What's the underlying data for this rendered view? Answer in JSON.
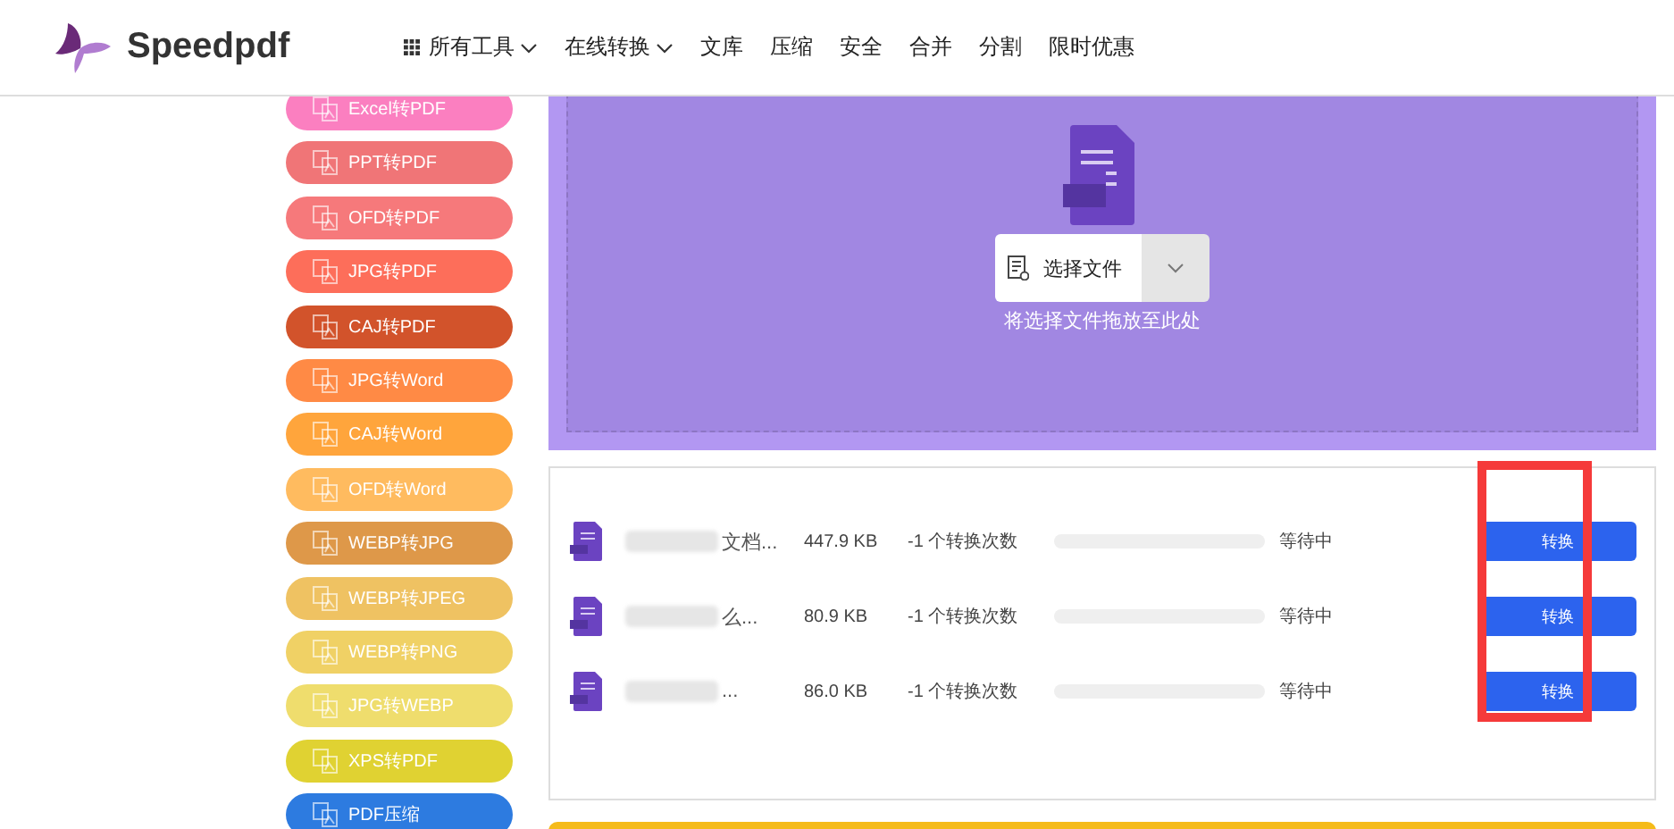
{
  "header": {
    "brand": "Speedpdf",
    "nav": [
      {
        "label": "所有工具",
        "kind": "grid-dropdown"
      },
      {
        "label": "在线转换",
        "kind": "dropdown"
      },
      {
        "label": "文库",
        "kind": "link"
      },
      {
        "label": "压缩",
        "kind": "link"
      },
      {
        "label": "安全",
        "kind": "link"
      },
      {
        "label": "合并",
        "kind": "link"
      },
      {
        "label": "分割",
        "kind": "link"
      },
      {
        "label": "限时优惠",
        "kind": "link"
      }
    ]
  },
  "sidebar": {
    "items": [
      {
        "label": "Excel转PDF",
        "color": "#fb7fc0"
      },
      {
        "label": "PPT转PDF",
        "color": "#f07577"
      },
      {
        "label": "OFD转PDF",
        "color": "#f6797b"
      },
      {
        "label": "JPG转PDF",
        "color": "#fd6e5a"
      },
      {
        "label": "CAJ转PDF",
        "color": "#d2532b"
      },
      {
        "label": "JPG转Word",
        "color": "#ff8a45"
      },
      {
        "label": "CAJ转Word",
        "color": "#ffa53c"
      },
      {
        "label": "OFD转Word",
        "color": "#ffbb5f"
      },
      {
        "label": "WEBP转JPG",
        "color": "#de9849"
      },
      {
        "label": "WEBP转JPEG",
        "color": "#efc262"
      },
      {
        "label": "WEBP转PNG",
        "color": "#f0d165"
      },
      {
        "label": "JPG转WEBP",
        "color": "#efdd6d"
      },
      {
        "label": "XPS转PDF",
        "color": "#e0d232"
      },
      {
        "label": "PDF压缩",
        "color": "#2d7be0"
      }
    ]
  },
  "upload": {
    "button": "选择文件",
    "hint": "将选择文件拖放至此处"
  },
  "files": [
    {
      "name": "文档...",
      "size": "447.9 KB",
      "count": "-1 个转换次数",
      "level": 0,
      "status": "等待中",
      "action": "转换"
    },
    {
      "name": "么...",
      "size": "80.9 KB",
      "count": "-1 个转换次数",
      "level": 0,
      "status": "等待中",
      "action": "转换"
    },
    {
      "name": "...",
      "size": "86.0 KB",
      "count": "-1 个转换次数",
      "level": 0,
      "status": "等待中",
      "action": "转换"
    }
  ],
  "highlight": {
    "kind": "annotation-box"
  }
}
